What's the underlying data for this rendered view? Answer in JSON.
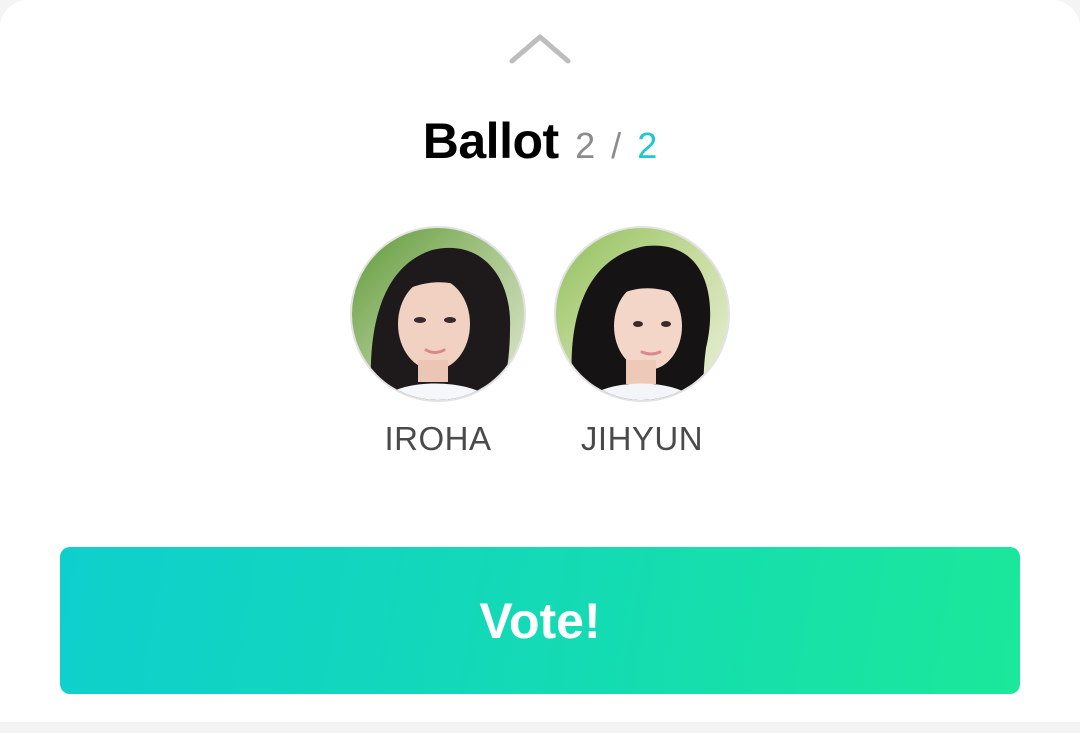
{
  "ballot": {
    "title": "Ballot",
    "count_current": "2",
    "count_separator": "/",
    "count_total": "2"
  },
  "candidates": [
    {
      "name": "IROHA",
      "avatar": "avatar-photo"
    },
    {
      "name": "JIHYUN",
      "avatar": "avatar-photo"
    }
  ],
  "vote_button": {
    "label": "Vote!"
  },
  "icons": {
    "handle": "chevron-up-icon"
  },
  "colors": {
    "accent": "#1cc8d2",
    "button_gradient_start": "#0fcfcd",
    "button_gradient_end": "#1be89a",
    "muted_text": "#8c8c8c",
    "name_text": "#4a4a4a"
  }
}
